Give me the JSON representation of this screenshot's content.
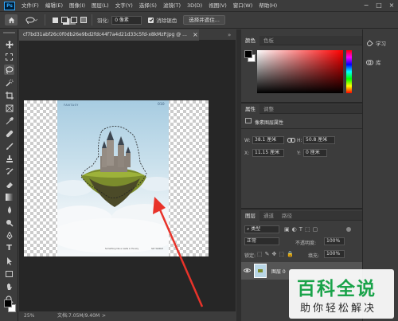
{
  "menubar": {
    "app_icon": "Ps",
    "items": [
      "文件(F)",
      "编辑(E)",
      "图像(I)",
      "图层(L)",
      "文字(Y)",
      "选择(S)",
      "滤镜(T)",
      "3D(D)",
      "视图(V)",
      "窗口(W)",
      "帮助(H)"
    ],
    "minimize": "−",
    "maximize": "□",
    "close": "×"
  },
  "options": {
    "feather_label": "羽化:",
    "feather_value": "0 像素",
    "antialias_label": "消除锯齿",
    "select_mask_button": "选择并遮住...",
    "home_icon": "home-icon",
    "lasso_icon": "lasso-icon"
  },
  "document": {
    "tab_title": "cf7bd31abf26c0f0db26e9bd2fdc44f7a4d21d33c5fd-x8kMzP.jpg @ ...",
    "tab_close": "×",
    "tab_collapse": "»",
    "zoom": "25%",
    "doc_info": "文档:7.05M/9.40M",
    "status_arrow": ">"
  },
  "poster": {
    "brand": "FANTASY",
    "number": "010",
    "footer_left": "Something like a castle in the sky",
    "footer_right": "SKY WORLD"
  },
  "color_panel": {
    "tabs": [
      "颜色",
      "色板"
    ],
    "foreground": "#000000",
    "background": "#ffffff",
    "hue_selected": "#ff0000"
  },
  "properties_panel": {
    "tabs": [
      "属性",
      "调整"
    ],
    "layer_type": "像素图层属性",
    "w_label": "W:",
    "w_value": "38.1 厘米",
    "h_label": "H:",
    "h_value": "50.8 厘米",
    "x_label": "X:",
    "x_value": "11.15 厘米",
    "y_label": "Y:",
    "y_value": "0 厘米",
    "link_icon": "link-icon"
  },
  "layers_panel": {
    "tabs": [
      "图层",
      "通道",
      "路径"
    ],
    "filter_label": "类型",
    "blend_mode": "正常",
    "opacity_label": "不透明度:",
    "opacity_value": "100%",
    "lock_label": "锁定:",
    "fill_label": "填充:",
    "fill_value": "100%",
    "layers": [
      {
        "name": "图层 0",
        "visible": true
      }
    ]
  },
  "right_column": {
    "items": [
      {
        "icon": "learn-icon",
        "label": "学习"
      },
      {
        "icon": "libraries-icon",
        "label": "库"
      }
    ]
  },
  "watermark": {
    "title": "百科全说",
    "subtitle": "助你轻松解决"
  },
  "toolbar": {
    "foreground": "#000000",
    "background": "#ffffff"
  }
}
